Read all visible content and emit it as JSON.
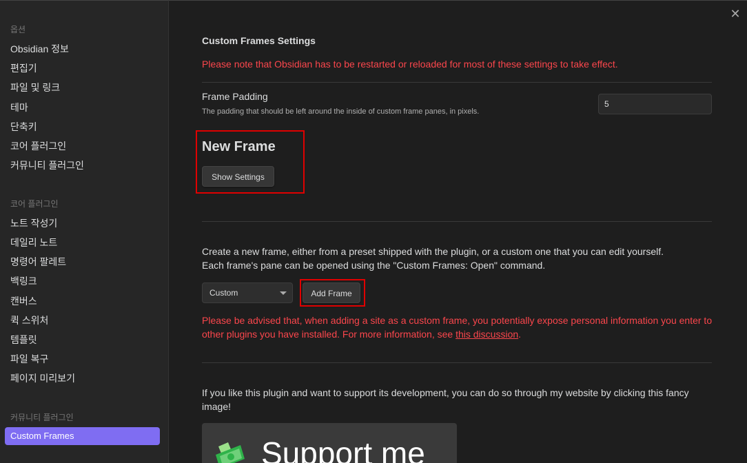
{
  "sidebar": {
    "options_heading": "옵션",
    "options_items": [
      "Obsidian 정보",
      "편집기",
      "파일 및 링크",
      "테마",
      "단축키",
      "코어 플러그인",
      "커뮤니티 플러그인"
    ],
    "core_heading": "코어 플러그인",
    "core_items": [
      "노트 작성기",
      "데일리 노트",
      "명령어 팔레트",
      "백링크",
      "캔버스",
      "퀵 스위처",
      "템플릿",
      "파일 복구",
      "페이지 미리보기"
    ],
    "community_heading": "커뮤니티 플러그인",
    "active_item": "Custom Frames"
  },
  "main": {
    "title": "Custom Frames Settings",
    "restart_notice": "Please note that Obsidian has to be restarted or reloaded for most of these settings to take effect.",
    "padding_setting": {
      "name": "Frame Padding",
      "description": "The padding that should be left around the inside of custom frame panes, in pixels.",
      "value": "5"
    },
    "new_frame": {
      "title": "New Frame",
      "show_settings_label": "Show Settings"
    },
    "create_text_1": "Create a new frame, either from a preset shipped with the plugin, or a custom one that you can edit yourself.",
    "create_text_2": "Each frame's pane can be opened using the \"Custom Frames: Open\" command.",
    "preset_select_value": "Custom",
    "add_frame_label": "Add Frame",
    "warning_prefix": "Please be advised that, when adding a site as a custom frame, you potentially expose personal information you enter to other plugins you have installed. For more information, see ",
    "warning_link": "this discussion",
    "warning_suffix": ".",
    "support_text": "If you like this plugin and want to support its development, you can do so through my website by clicking this fancy image!",
    "support_image_text": "Support me"
  },
  "colors": {
    "accent": "#7f6df2",
    "warning": "#fb464c",
    "highlight_box": "#e00000"
  }
}
